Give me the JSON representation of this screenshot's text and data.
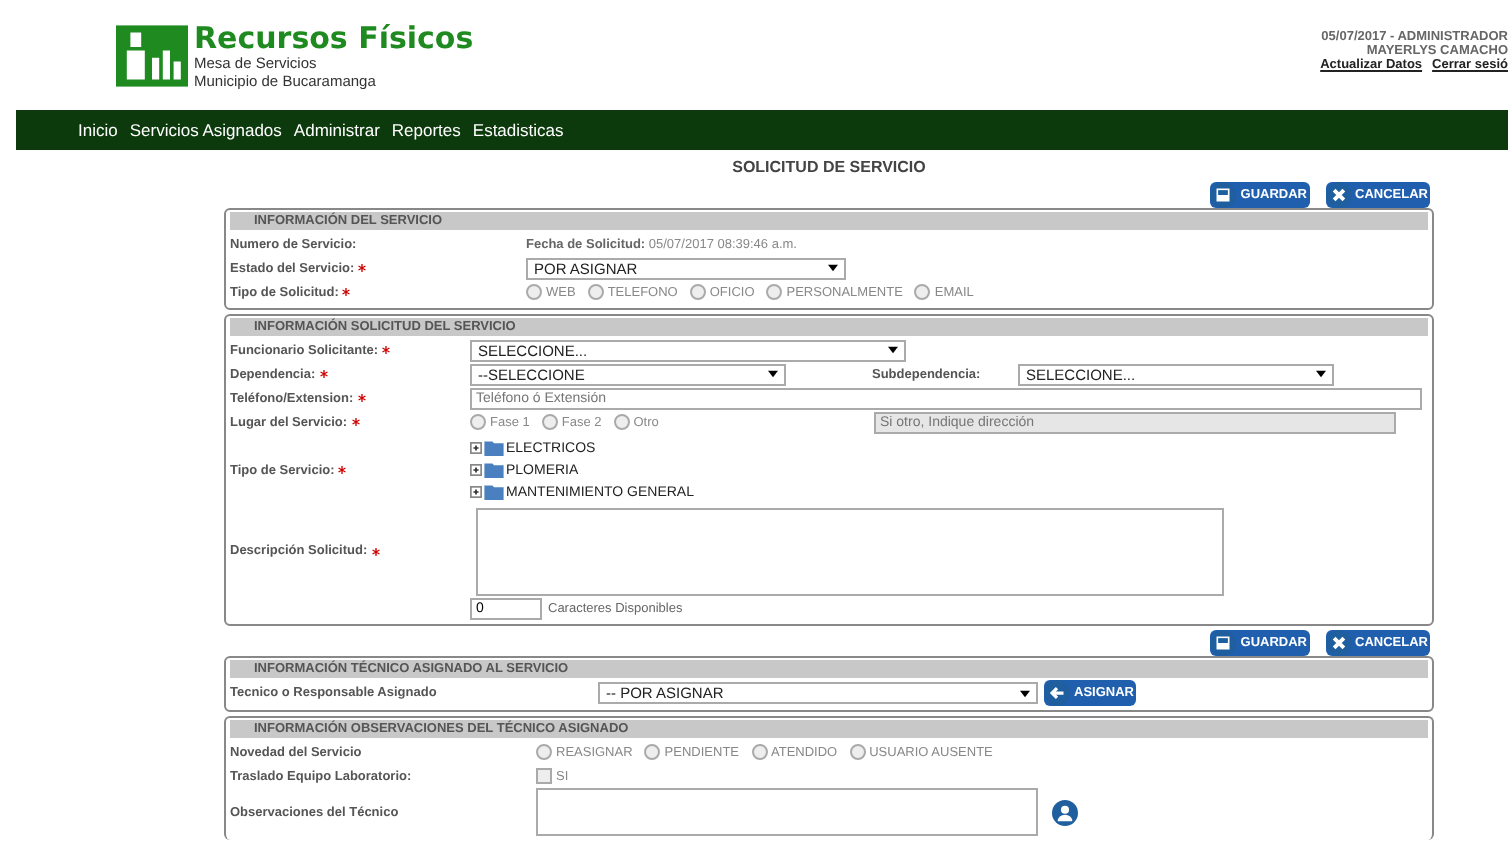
{
  "header": {
    "logo_title": "Recursos Físicos",
    "logo_lines": [
      "Mesa de Servicios",
      "Municipio de Bucaramanga"
    ],
    "user_line": "05/07/2017 - ADMINISTRADOR",
    "user_name": "MAYERLYS CAMACHO",
    "links": [
      "Actualizar Datos",
      "Cerrar sesió"
    ]
  },
  "nav": [
    "Inicio",
    "Servicios Asignados",
    "Administrar",
    "Reportes",
    "Estadisticas"
  ],
  "page_title": "SOLICITUD DE SERVICIO",
  "actions": [
    {
      "label": "GUARDAR",
      "kind": "save"
    },
    {
      "label": "CANCELAR",
      "kind": "cancel"
    }
  ],
  "servicio": {
    "title": "INFORMACIÓN DEL SERVICIO",
    "numero_label": "Numero de Servicio:",
    "fecha_label": "Fecha de Solicitud:",
    "fecha_value": "05/07/2017 08:39:46 a.m.",
    "estado_label": "Estado del Servicio:",
    "estado_value": "POR ASIGNAR",
    "tipo_label": "Tipo de Solicitud:",
    "tipo_options": [
      {
        "label": "WEB",
        "selected": false
      },
      {
        "label": "TELEFONO",
        "selected": false
      },
      {
        "label": "OFICIO",
        "selected": false
      },
      {
        "label": "PERSONALMENTE",
        "selected": false
      },
      {
        "label": "EMAIL",
        "selected": false
      }
    ]
  },
  "solicitud": {
    "title": "INFORMACIÓN SOLICITUD DEL SERVICIO",
    "funcionario_label": "Funcionario Solicitante:",
    "funcionario_value": "SELECCIONE...",
    "dependencia_label": "Dependencia:",
    "dependencia_value": "--SELECCIONE",
    "subdependencia_label": "Subdependencia:",
    "subdependencia_value": "SELECCIONE...",
    "telefono_label": "Teléfono/Extension:",
    "telefono_placeholder": "Teléfono ó Extensión",
    "lugar_label": "Lugar del Servicio:",
    "lugar_options": [
      {
        "label": "Fase 1",
        "selected": false
      },
      {
        "label": "Fase 2",
        "selected": false
      },
      {
        "label": "Otro",
        "selected": false
      }
    ],
    "lugar_placeholder": "Si otro, Indique dirección",
    "tipo_label": "Tipo de Servicio:",
    "tree": [
      {
        "label": "ELECTRICOS",
        "expanded": false
      },
      {
        "label": "PLOMERIA",
        "expanded": false
      },
      {
        "label": "MANTENIMIENTO GENERAL",
        "expanded": false
      }
    ],
    "descripcion_label": "Descripción Solicitud:",
    "counter_value": "0",
    "counter_text": "Caracteres Disponibles"
  },
  "actions_bottom": [
    {
      "label": "GUARDAR",
      "kind": "save"
    },
    {
      "label": "CANCELAR",
      "kind": "cancel"
    }
  ],
  "tecnico": {
    "title": "INFORMACIÓN TÉCNICO ASIGNADO AL SERVICIO",
    "label": "Tecnico o Responsable Asignado",
    "value": "-- POR ASIGNAR",
    "button": "ASIGNAR"
  },
  "observaciones": {
    "title": "INFORMACIÓN OBSERVACIONES DEL TÉCNICO ASIGNADO",
    "novedad_label": "Novedad del Servicio",
    "novedad_options": [
      {
        "label": "REASIGNAR",
        "selected": false
      },
      {
        "label": "PENDIENTE",
        "selected": false
      },
      {
        "label": "ATENDIDO",
        "selected": false
      },
      {
        "label": "USUARIO AUSENTE",
        "selected": false
      }
    ],
    "traslado_label": "Traslado Equipo Laboratorio:",
    "traslado_option": {
      "label": "SI",
      "checked": false
    },
    "obs_label": "Observaciones del Técnico"
  }
}
